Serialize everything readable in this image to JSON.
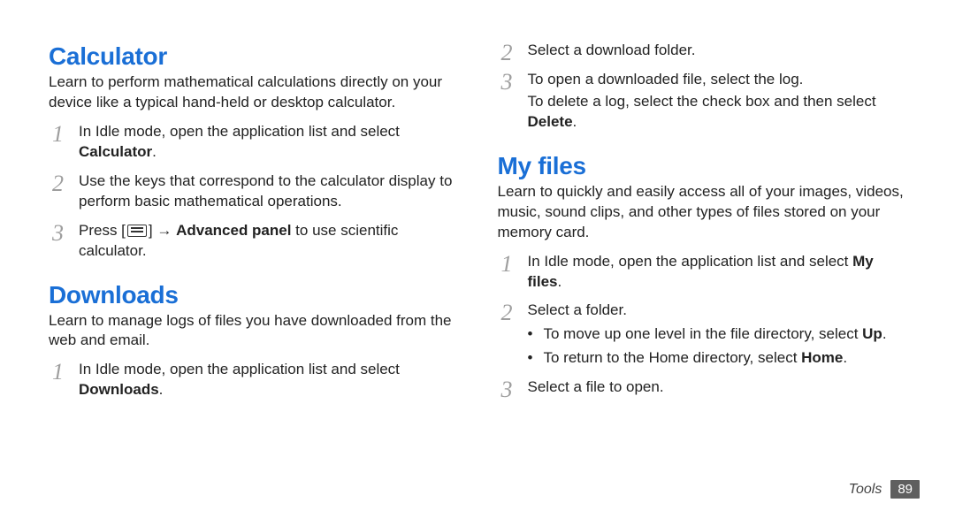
{
  "left": {
    "calculator": {
      "heading": "Calculator",
      "intro": "Learn to perform mathematical calculations directly on your device like a typical hand-held or desktop calculator.",
      "steps": {
        "s1_a": "In Idle mode, open the application list and select ",
        "s1_b": "Calculator",
        "s1_c": ".",
        "s2": "Use the keys that correspond to the calculator display to perform basic mathematical operations.",
        "s3_a": "Press [",
        "s3_b": "] → ",
        "s3_c": "Advanced panel",
        "s3_d": " to use scientific calculator."
      }
    },
    "downloads": {
      "heading": "Downloads",
      "intro": "Learn to manage logs of files you have downloaded from the web and email.",
      "steps": {
        "s1_a": "In Idle mode, open the application list and select ",
        "s1_b": "Downloads",
        "s1_c": "."
      }
    }
  },
  "right": {
    "top_steps": {
      "s2": "Select a download folder.",
      "s3_a": "To open a downloaded file, select the log.",
      "s3_b": "To delete a log, select the check box and then select ",
      "s3_c": "Delete",
      "s3_d": "."
    },
    "myfiles": {
      "heading": "My files",
      "intro": "Learn to quickly and easily access all of your images, videos, music, sound clips, and other types of files stored on your memory card.",
      "steps": {
        "s1_a": "In Idle mode, open the application list and select ",
        "s1_b": "My files",
        "s1_c": ".",
        "s2": "Select a folder.",
        "s2_b1_a": "To move up one level in the file directory, select ",
        "s2_b1_b": "Up",
        "s2_b1_c": ".",
        "s2_b2_a": "To return to the Home directory, select ",
        "s2_b2_b": "Home",
        "s2_b2_c": ".",
        "s3": "Select a file to open."
      }
    }
  },
  "footer": {
    "section": "Tools",
    "page": "89"
  }
}
